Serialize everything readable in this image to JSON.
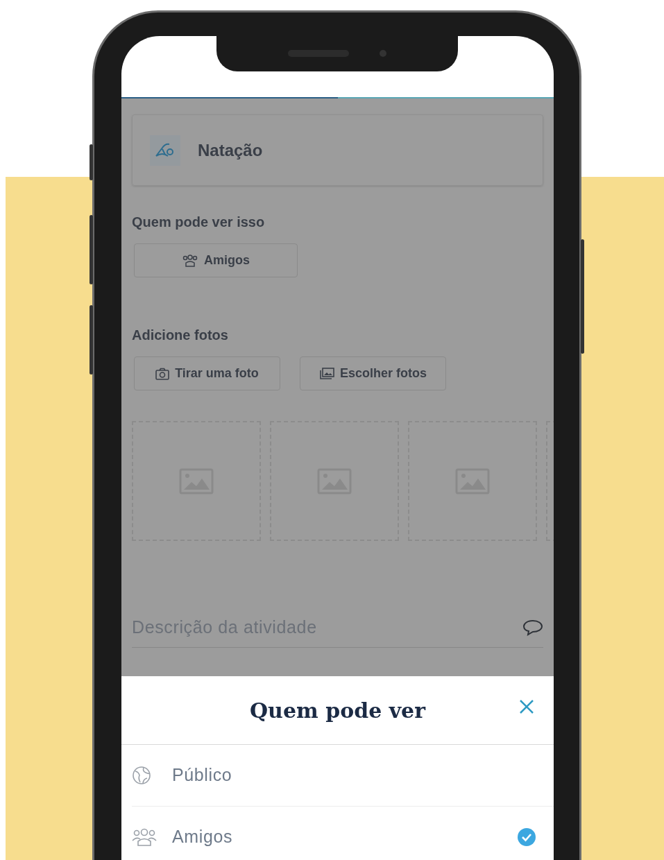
{
  "progress": {
    "level": 0.5
  },
  "activity": {
    "name": "Natação"
  },
  "visibility": {
    "label": "Quem pode ver isso",
    "button": "Amigos"
  },
  "photos": {
    "label": "Adicione fotos",
    "buttons": [
      {
        "kind": "camera",
        "label": "Tirar uma foto"
      },
      {
        "kind": "gallery",
        "label": "Escolher fotos"
      }
    ],
    "slots": [
      {
        "kind": "empty"
      },
      {
        "kind": "empty"
      },
      {
        "kind": "empty"
      },
      {
        "kind": "empty"
      }
    ]
  },
  "description": {
    "placeholder": "Descrição da atividade"
  },
  "sheet": {
    "title": "Quem pode ver",
    "options": [
      {
        "kind": "public",
        "label": "Público",
        "selected": false
      },
      {
        "kind": "friends",
        "label": "Amigos",
        "selected": true
      }
    ]
  }
}
